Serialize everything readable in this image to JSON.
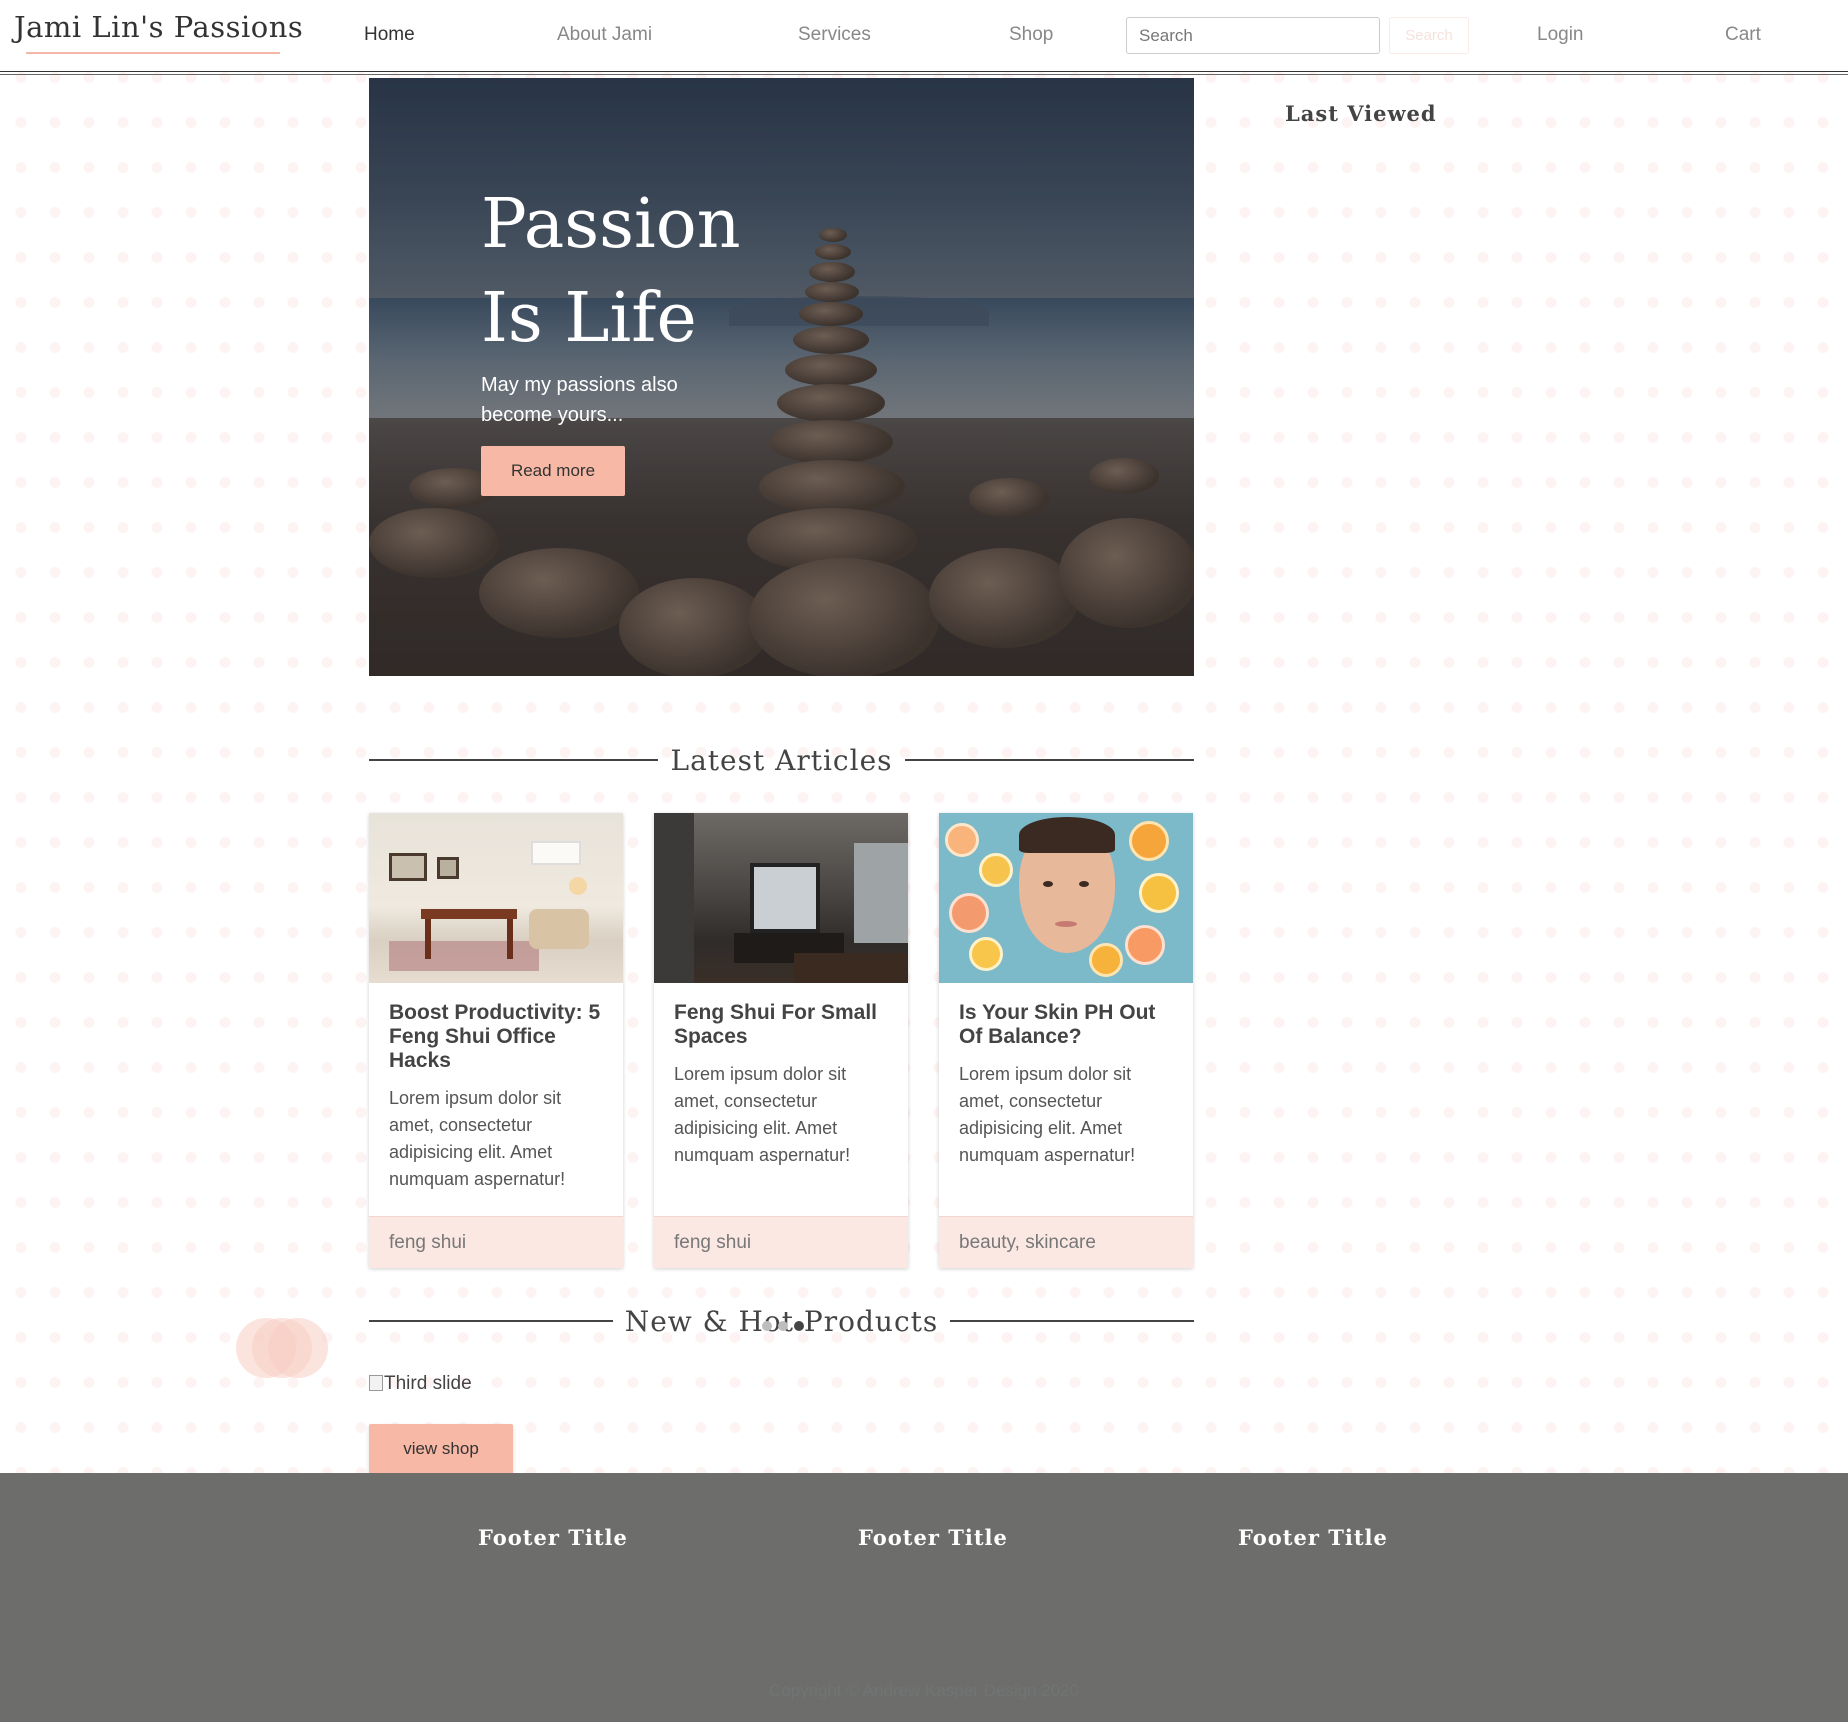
{
  "nav": {
    "brand": "Jami Lin's Passions",
    "links": [
      "Home",
      "About Jami",
      "Services",
      "Shop"
    ],
    "search_placeholder": "Search",
    "search_button": "Search",
    "login": "Login",
    "cart": "Cart",
    "accent_color": "#f7b8a6"
  },
  "hero": {
    "title_line1": "Passion",
    "title_line2": "Is Life",
    "subtitle": "May my passions also become yours...",
    "button": "Read more"
  },
  "sidebar": {
    "heading": "Last Viewed"
  },
  "articles": {
    "heading": "Latest Articles",
    "items": [
      {
        "title": "Boost Productivity: 5 Feng Shui Office Hacks",
        "text": "Lorem ipsum dolor sit amet, consectetur adipisicing elit. Amet numquam aspernatur!",
        "tags": "feng shui"
      },
      {
        "title": "Feng Shui For Small Spaces",
        "text": "Lorem ipsum dolor sit amet, consectetur adipisicing elit. Amet numquam aspernatur!",
        "tags": "feng shui"
      },
      {
        "title": "Is Your Skin PH Out Of Balance?",
        "text": "Lorem ipsum dolor sit amet, consectetur adipisicing elit. Amet numquam aspernatur!",
        "tags": "beauty, skincare"
      }
    ]
  },
  "products": {
    "heading": "New & Hot Products",
    "slide_alt": "Third slide",
    "button": "view shop"
  },
  "footer": {
    "titles": [
      "Footer Title",
      "Footer Title",
      "Footer Title"
    ],
    "copyright": "Copyright © Andrew Kasper Design 2020",
    "background": "#6d6d6b"
  }
}
